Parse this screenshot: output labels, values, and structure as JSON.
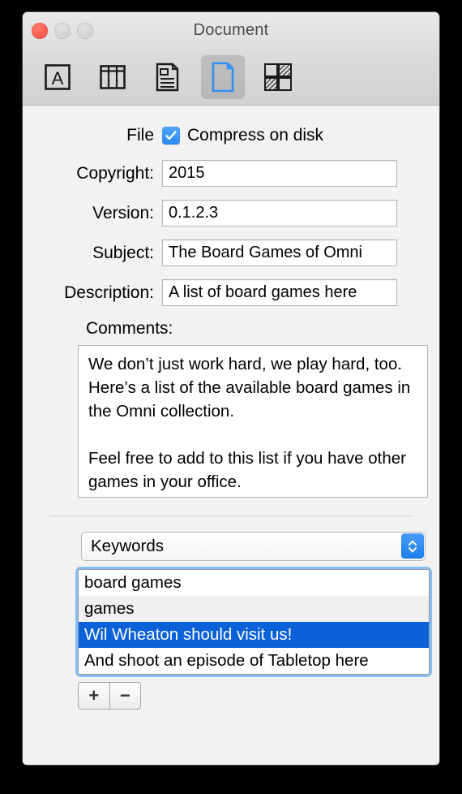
{
  "window": {
    "title": "Document",
    "traffic_lights": [
      {
        "name": "close",
        "color": "#fc5d51"
      },
      {
        "name": "minimize",
        "color": "#d4d4d4"
      },
      {
        "name": "zoom",
        "color": "#d4d4d4"
      }
    ]
  },
  "toolbar": {
    "items": [
      {
        "icon": "letter-a-in-box-icon",
        "selected": false
      },
      {
        "icon": "table-columns-icon",
        "selected": false
      },
      {
        "icon": "document-with-text-lines-icon",
        "selected": false
      },
      {
        "icon": "blank-document-icon",
        "selected": true
      },
      {
        "icon": "checkerboard-hatch-icon",
        "selected": false
      }
    ],
    "selected_index": 3,
    "selected_accent": "#2f8ff5"
  },
  "form": {
    "file": {
      "label": "File",
      "checkbox_label": "Compress on disk",
      "checked": true,
      "checkbox_color": "#2c8bf2"
    },
    "fields": [
      {
        "label": "Copyright:",
        "value": "2015",
        "placeholder": ""
      },
      {
        "label": "Version:",
        "value": "0.1.2.3",
        "placeholder": ""
      },
      {
        "label": "Subject:",
        "value": "The Board Games of Omni",
        "placeholder": ""
      },
      {
        "label": "Description:",
        "value": "A list of board games here",
        "placeholder": ""
      }
    ],
    "comments": {
      "label": "Comments:",
      "value": "We don’t just work hard, we play hard, too. Here’s a list of the available board games in the Omni collection.\n\nFeel free to add to this list if you have other games in your office."
    }
  },
  "keywords": {
    "popup_label": "Keywords",
    "items": [
      {
        "text": "board games",
        "selected": false
      },
      {
        "text": "games",
        "selected": false
      },
      {
        "text": "Wil Wheaton should visit us!",
        "selected": true
      },
      {
        "text": "And shoot an episode of Tabletop here",
        "selected": false
      }
    ],
    "selection_color": "#0a61d8",
    "focus_ring_color": "#64aaf5",
    "add_label": "+",
    "remove_label": "−"
  }
}
